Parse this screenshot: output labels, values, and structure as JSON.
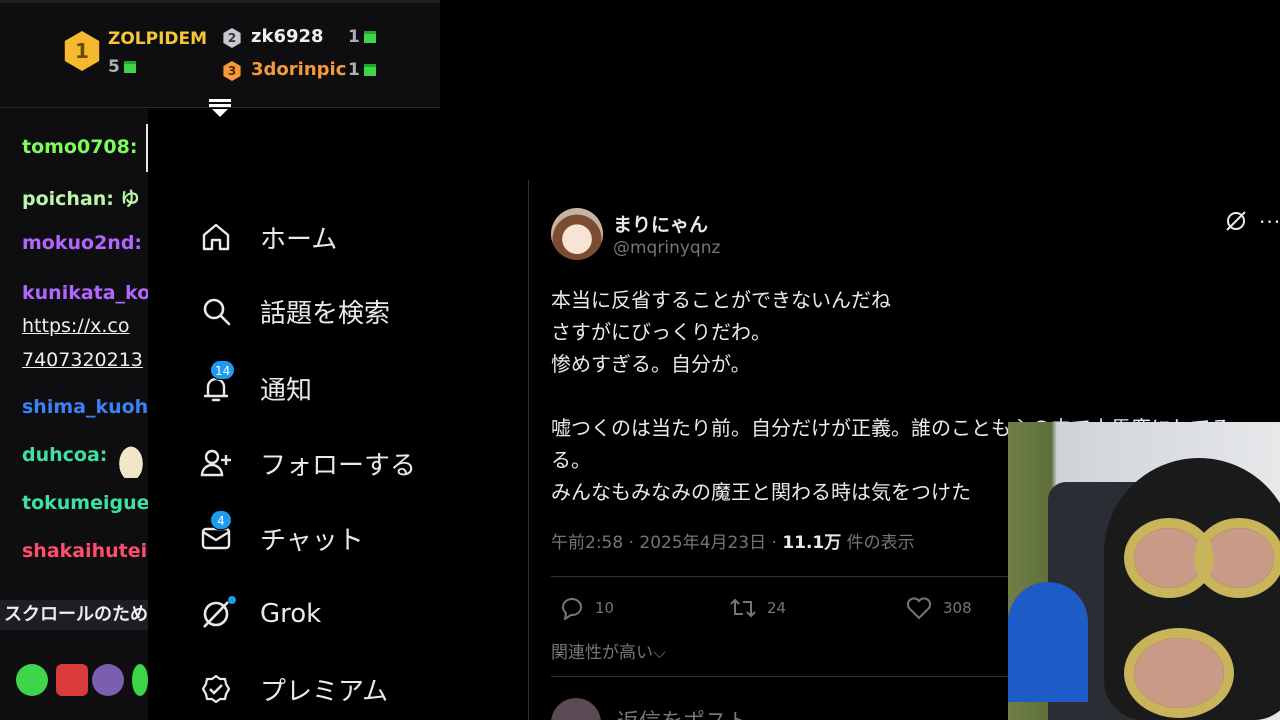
{
  "leaderboard": {
    "first": {
      "rank": "1",
      "name": "ZOLPIDEM",
      "count": "5"
    },
    "second": {
      "rank": "2",
      "name": "zk6928",
      "count": "1"
    },
    "third": {
      "rank": "3",
      "name": "3dorinpic",
      "count": "1"
    },
    "colors": {
      "gold": "#f5b82e",
      "silver": "#c8c8d0",
      "bronze": "#f49a3d",
      "bits": "#3ed54a"
    }
  },
  "chat": {
    "messages": [
      {
        "user": "tomo0708:",
        "color": "#7dfc5c"
      },
      {
        "user": "poichan: ゆ",
        "color": "#b9f6a6"
      },
      {
        "user": "mokuo2nd:",
        "color": "#b266ff"
      },
      {
        "user": "kunikata_ko",
        "color": "#b266ff"
      },
      {
        "user": "shima_kuoh",
        "color": "#3b82f6"
      },
      {
        "user": "duhcoa:",
        "color": "#3fe0a0"
      },
      {
        "user": "tokumeigue",
        "color": "#3fe0a0"
      },
      {
        "user": "shakaihutei",
        "color": "#ff4d6d"
      }
    ],
    "link_line1": "https://x.co",
    "link_line2": "7407320213",
    "scroll_notice": "スクロールのため"
  },
  "x_nav": {
    "items": [
      {
        "label": "ホーム",
        "icon": "home-icon"
      },
      {
        "label": "話題を検索",
        "icon": "search-icon"
      },
      {
        "label": "通知",
        "icon": "bell-icon",
        "badge": "14"
      },
      {
        "label": "フォローする",
        "icon": "follow-icon"
      },
      {
        "label": "チャット",
        "icon": "mail-icon",
        "badge": "4"
      },
      {
        "label": "Grok",
        "icon": "grok-icon"
      },
      {
        "label": "プレミアム",
        "icon": "verified-icon"
      }
    ]
  },
  "tweet": {
    "display_name": "まりにゃん",
    "handle": "@mqrinyqnz",
    "body": "本当に反省することができないんだね\nさすがにびっくりだわ。\n惨めすぎる。自分が。\n\n嘘つくのは当たり前。自分だけが正義。誰のことも心の中で小馬鹿にしてる。\nる。\nみんなもみなみの魔王と関わる時は気をつけた",
    "time": "午前2:58 · 2025年4月23日 · ",
    "views": "11.1万",
    "views_suffix": " 件の表示",
    "replies": "10",
    "retweets": "24",
    "likes": "308",
    "relevance": "関連性が高い⌵",
    "reply_placeholder": "返信をポスト"
  },
  "accent": "#1d9bf0"
}
